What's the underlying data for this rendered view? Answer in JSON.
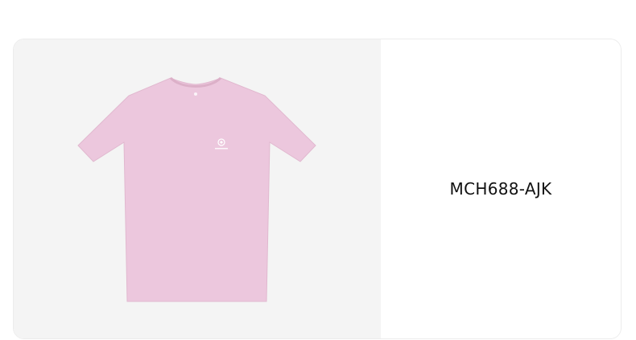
{
  "product": {
    "sku": "MCH688-AJK",
    "image_icon": "tshirt-image",
    "shirt_color": "#ecc7dd"
  }
}
